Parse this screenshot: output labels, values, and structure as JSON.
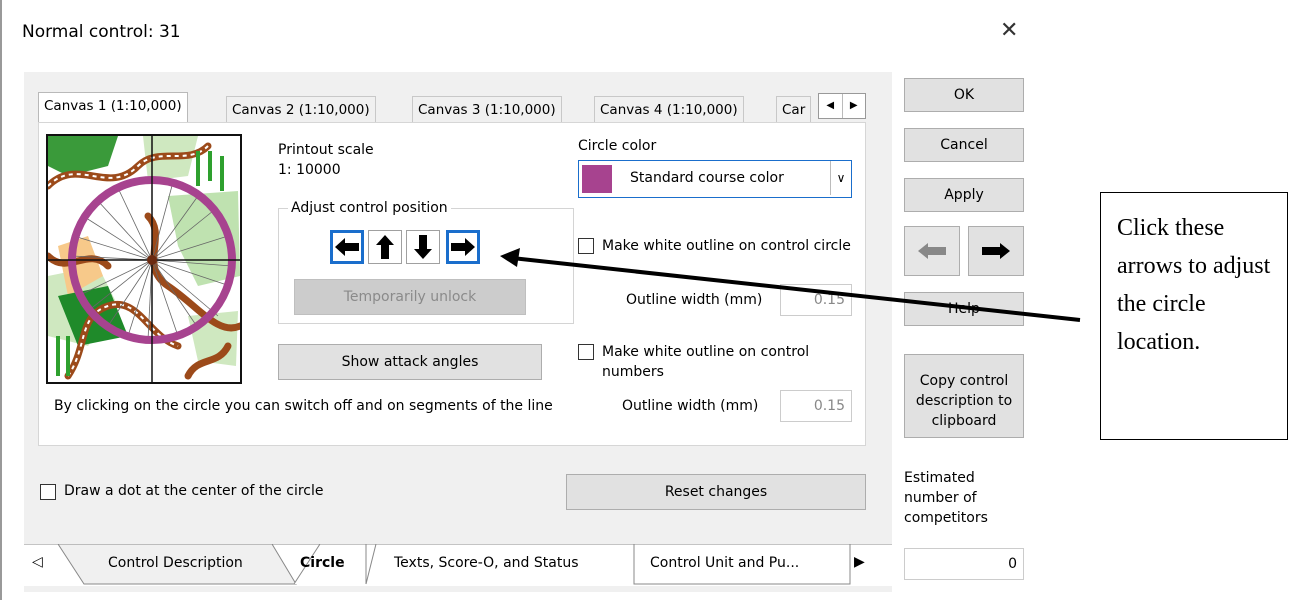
{
  "window": {
    "title": "Normal control: 31",
    "close_icon": "close-icon"
  },
  "canvas_tabs": [
    {
      "label": "Canvas 1  (1:10,000)",
      "active": true
    },
    {
      "label": "Canvas 2  (1:10,000)",
      "active": false
    },
    {
      "label": "Canvas 3  (1:10,000)",
      "active": false
    },
    {
      "label": "Canvas 4  (1:10,000)",
      "active": false
    },
    {
      "label": "Car",
      "active": false
    }
  ],
  "printout": {
    "label": "Printout scale",
    "value": "1: 10000"
  },
  "adjust": {
    "group_label": "Adjust control position",
    "arrows": [
      "left-arrow-icon",
      "up-arrow-icon",
      "down-arrow-icon",
      "right-arrow-icon"
    ],
    "unlock_label": "Temporarily unlock"
  },
  "attack_label": "Show attack angles",
  "segments_note": "By clicking on the circle you can switch off and on segments of the line",
  "circle_color": {
    "label": "Circle color",
    "value": "Standard course color",
    "swatch": "#a7438f"
  },
  "outline_circle": {
    "label": "Make white outline on control circle",
    "width_label": "Outline width (mm)",
    "width_value": "0.15",
    "checked": false
  },
  "outline_numbers": {
    "label": "Make white outline on control numbers",
    "width_label": "Outline width (mm)",
    "width_value": "0.15",
    "checked": false
  },
  "dot_center": {
    "label": "Draw a dot at the center of the circle",
    "checked": false
  },
  "reset_label": "Reset changes",
  "bottom_tabs": [
    {
      "label": "Control Description",
      "active": false
    },
    {
      "label": "Circle",
      "active": true
    },
    {
      "label": "Texts, Score-O, and Status",
      "active": false
    },
    {
      "label": "Control Unit and Pu...",
      "active": false
    }
  ],
  "right": {
    "ok": "OK",
    "cancel": "Cancel",
    "apply": "Apply",
    "help": "Help",
    "copy": "Copy control description to clipboard",
    "estimate_label": "Estimated number of competitors",
    "estimate_value": "0"
  },
  "callout": "Click these arrows to adjust the circle location.",
  "colors": {
    "accent": "#1a6ecc",
    "circle": "#a7438f"
  }
}
